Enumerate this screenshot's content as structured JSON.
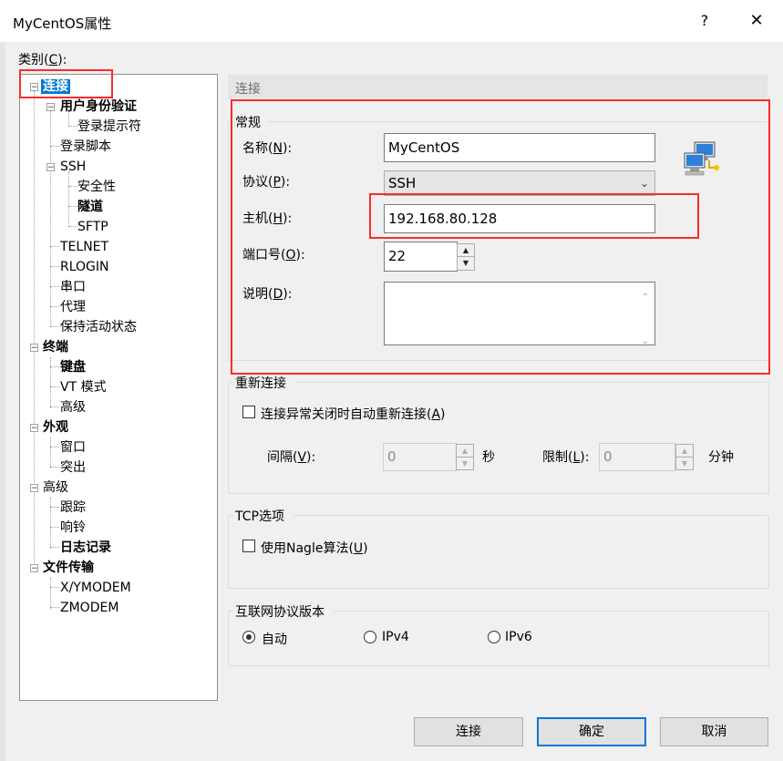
{
  "window": {
    "title": "MyCentOS属性",
    "help": "?",
    "close": "✕"
  },
  "category_label": "类别(C):",
  "category_label_parts": {
    "pre": "类别(",
    "key": "C",
    "post": "):"
  },
  "tree": {
    "connection": "连接",
    "user_auth": "用户身份验证",
    "login_prompt": "登录提示符",
    "login_script": "登录脚本",
    "ssh": "SSH",
    "security": "安全性",
    "tunnel": "隧道",
    "sftp": "SFTP",
    "telnet": "TELNET",
    "rlogin": "RLOGIN",
    "serial": "串口",
    "proxy": "代理",
    "keepalive": "保持活动状态",
    "terminal": "终端",
    "keyboard": "键盘",
    "vt_mode": "VT 模式",
    "advanced_term": "高级",
    "appearance": "外观",
    "window": "窗口",
    "highlight": "突出",
    "advanced": "高级",
    "trace": "跟踪",
    "bell": "响铃",
    "logging": "日志记录",
    "file_transfer": "文件传输",
    "xymodem": "X/YMODEM",
    "zmodem": "ZMODEM"
  },
  "section_title": "连接",
  "general": {
    "title": "常规",
    "name_label": {
      "pre": "名称(",
      "key": "N",
      "post": "):"
    },
    "name_value": "MyCentOS",
    "protocol_label": {
      "pre": "协议(",
      "key": "P",
      "post": "):"
    },
    "protocol_value": "SSH",
    "host_label": {
      "pre": "主机(",
      "key": "H",
      "post": "):"
    },
    "host_value": "192.168.80.128",
    "port_label": {
      "pre": "端口号(",
      "key": "O",
      "post": "):"
    },
    "port_value": "22",
    "desc_label": {
      "pre": "说明(",
      "key": "D",
      "post": "):"
    },
    "desc_value": ""
  },
  "reconnect": {
    "title": "重新连接",
    "auto_label": {
      "pre": "连接异常关闭时自动重新连接(",
      "key": "A",
      "post": ")"
    },
    "auto_checked": false,
    "interval_label": {
      "pre": "间隔(",
      "key": "V",
      "post": "):"
    },
    "interval_value": "0",
    "interval_unit": "秒",
    "limit_label": {
      "pre": "限制(",
      "key": "L",
      "post": "):"
    },
    "limit_value": "0",
    "limit_unit": "分钟"
  },
  "tcp": {
    "title": "TCP选项",
    "nagle_label": {
      "pre": "使用Nagle算法(",
      "key": "U",
      "post": ")"
    },
    "nagle_checked": false
  },
  "ip_version": {
    "title": "互联网协议版本",
    "options": [
      "自动",
      "IPv4",
      "IPv6"
    ],
    "selected": "自动"
  },
  "buttons": {
    "connect": "连接",
    "ok": "确定",
    "cancel": "取消"
  },
  "colors": {
    "highlight": "#ff2a2a",
    "selection": "#0078d7"
  }
}
